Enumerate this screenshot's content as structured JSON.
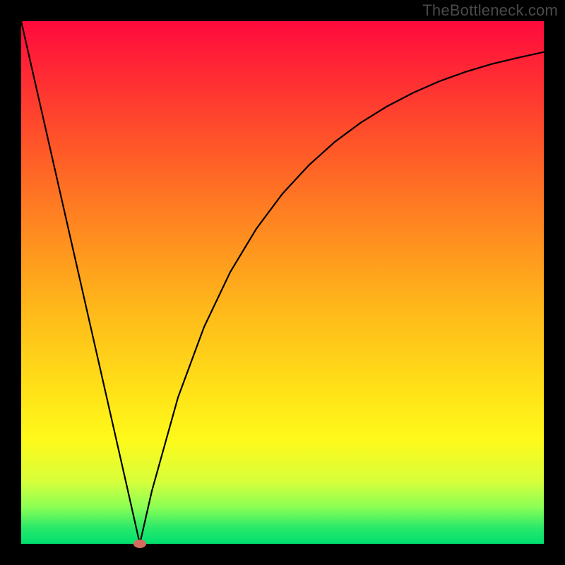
{
  "watermark": "TheBottleneck.com",
  "chart_data": {
    "type": "line",
    "title": "",
    "xlabel": "",
    "ylabel": "",
    "xlim": [
      0,
      100
    ],
    "ylim": [
      0,
      100
    ],
    "grid": false,
    "legend": false,
    "background_gradient": {
      "top_color": "#ff0a3c",
      "bottom_color": "#00e070",
      "meaning_top": "high bottleneck",
      "meaning_bottom": "no bottleneck"
    },
    "series": [
      {
        "name": "bottleneck-curve",
        "x": [
          0,
          5,
          10,
          15,
          20,
          22.7,
          25,
          30,
          35,
          40,
          45,
          50,
          55,
          60,
          65,
          70,
          75,
          80,
          85,
          90,
          95,
          100
        ],
        "values": [
          100,
          78,
          56,
          34,
          12,
          0,
          10.1,
          28.0,
          41.5,
          52.0,
          60.3,
          67.0,
          72.4,
          76.9,
          80.6,
          83.7,
          86.3,
          88.5,
          90.3,
          91.8,
          93.0,
          94.1
        ]
      }
    ],
    "marker": {
      "x": 22.7,
      "y": 0,
      "color": "#d46a5e"
    }
  }
}
